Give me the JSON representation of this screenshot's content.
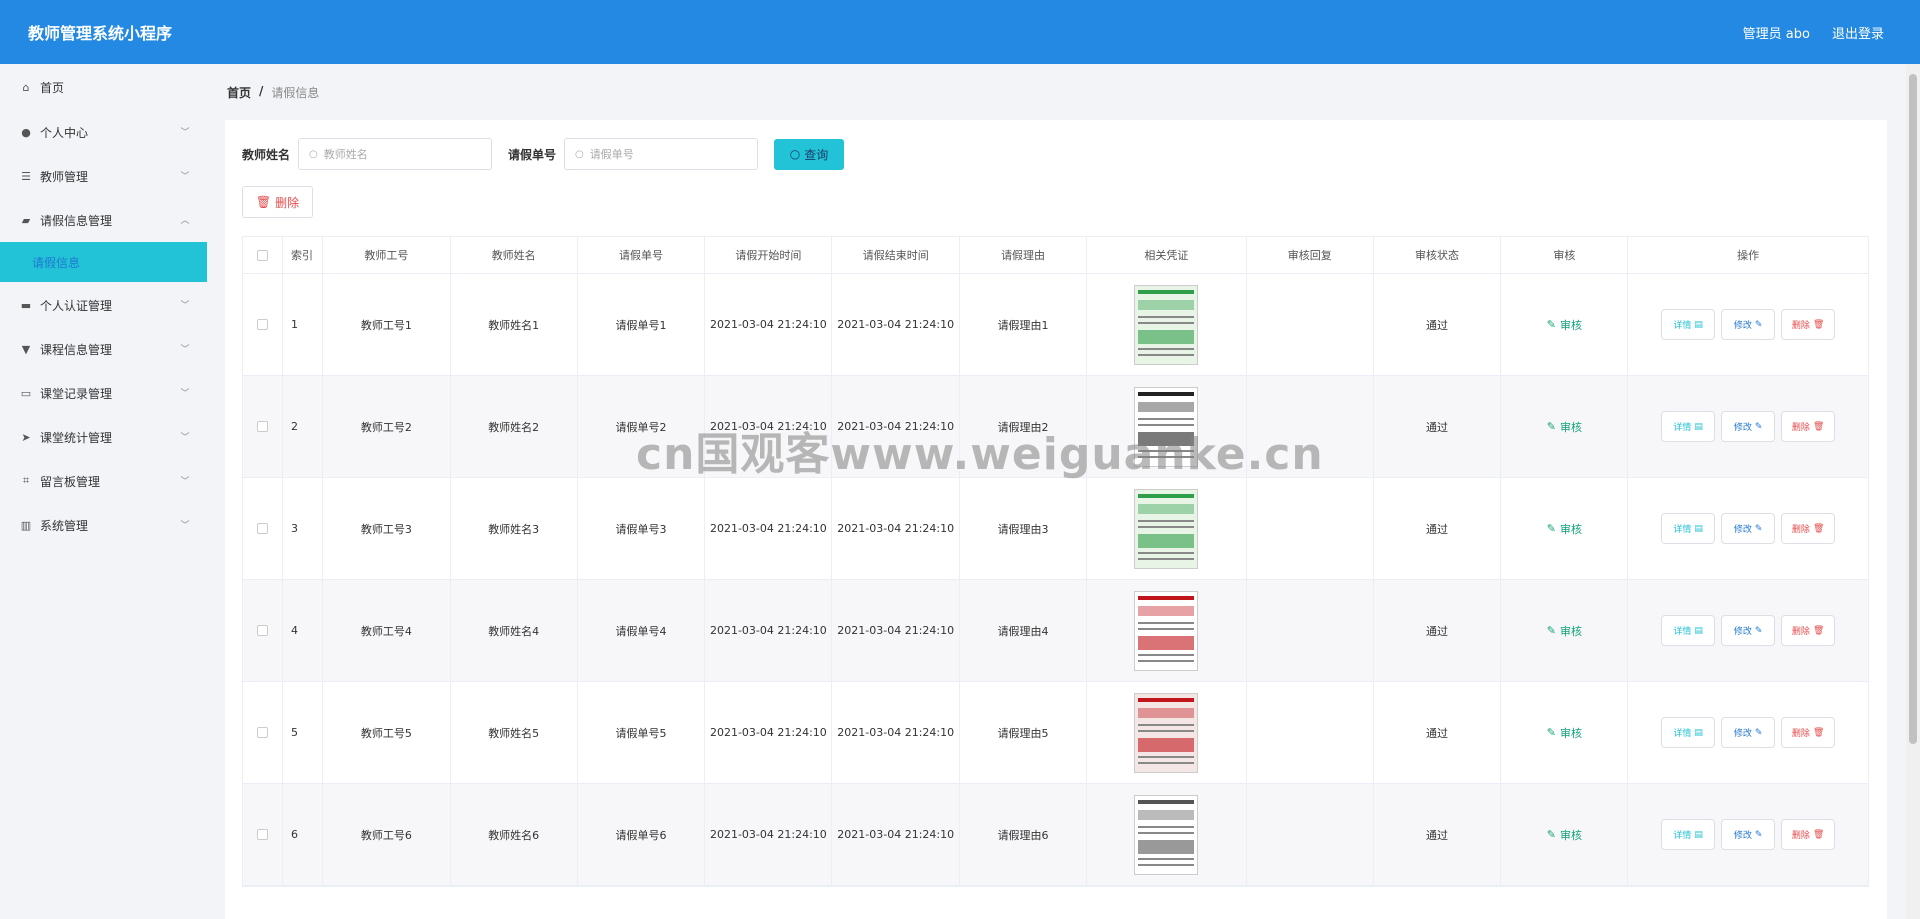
{
  "header": {
    "title": "教师管理系统小程序",
    "admin": "管理员 abo",
    "logout": "退出登录"
  },
  "sidebar": {
    "items": [
      {
        "label": "首页",
        "icon": "home-icon",
        "chevron": false
      },
      {
        "label": "个人中心",
        "icon": "user-icon",
        "chevron": true
      },
      {
        "label": "教师管理",
        "icon": "list-icon",
        "chevron": true
      },
      {
        "label": "请假信息管理",
        "icon": "folder-icon",
        "chevron": true,
        "expanded": true
      },
      {
        "label": "个人认证管理",
        "icon": "card-icon",
        "chevron": true
      },
      {
        "label": "课程信息管理",
        "icon": "book-icon",
        "chevron": true
      },
      {
        "label": "课堂记录管理",
        "icon": "message-icon",
        "chevron": true
      },
      {
        "label": "课堂统计管理",
        "icon": "send-icon",
        "chevron": true
      },
      {
        "label": "留言板管理",
        "icon": "crop-icon",
        "chevron": true
      },
      {
        "label": "系统管理",
        "icon": "chart-icon",
        "chevron": true
      }
    ],
    "subitem": "请假信息"
  },
  "breadcrumb": {
    "home": "首页",
    "sep": "/",
    "current": "请假信息"
  },
  "search": {
    "name_label": "教师姓名",
    "name_placeholder": "教师姓名",
    "no_label": "请假单号",
    "no_placeholder": "请假单号",
    "query": "查询"
  },
  "toolbar": {
    "delete": "删除"
  },
  "table": {
    "headers": [
      "",
      "索引",
      "教师工号",
      "教师姓名",
      "请假单号",
      "请假开始时间",
      "请假结束时间",
      "请假理由",
      "相关凭证",
      "审核回复",
      "审核状态",
      "审核",
      "操作"
    ],
    "rows": [
      {
        "index": "1",
        "no": "教师工号1",
        "name": "教师姓名1",
        "leave": "请假单号1",
        "start": "2021-03-04 21:24:10",
        "end": "2021-03-04 21:24:10",
        "reason": "请假理由1",
        "reply": "",
        "status": "通过",
        "audit": "审核"
      },
      {
        "index": "2",
        "no": "教师工号2",
        "name": "教师姓名2",
        "leave": "请假单号2",
        "start": "2021-03-04 21:24:10",
        "end": "2021-03-04 21:24:10",
        "reason": "请假理由2",
        "reply": "",
        "status": "通过",
        "audit": "审核"
      },
      {
        "index": "3",
        "no": "教师工号3",
        "name": "教师姓名3",
        "leave": "请假单号3",
        "start": "2021-03-04 21:24:10",
        "end": "2021-03-04 21:24:10",
        "reason": "请假理由3",
        "reply": "",
        "status": "通过",
        "audit": "审核"
      },
      {
        "index": "4",
        "no": "教师工号4",
        "name": "教师姓名4",
        "leave": "请假单号4",
        "start": "2021-03-04 21:24:10",
        "end": "2021-03-04 21:24:10",
        "reason": "请假理由4",
        "reply": "",
        "status": "通过",
        "audit": "审核"
      },
      {
        "index": "5",
        "no": "教师工号5",
        "name": "教师姓名5",
        "leave": "请假单号5",
        "start": "2021-03-04 21:24:10",
        "end": "2021-03-04 21:24:10",
        "reason": "请假理由5",
        "reply": "",
        "status": "通过",
        "audit": "审核"
      },
      {
        "index": "6",
        "no": "教师工号6",
        "name": "教师姓名6",
        "leave": "请假单号6",
        "start": "2021-03-04 21:24:10",
        "end": "2021-03-04 21:24:10",
        "reason": "请假理由6",
        "reply": "",
        "status": "通过",
        "audit": "审核"
      }
    ],
    "ops": {
      "detail": "详情",
      "edit": "修改",
      "delete": "删除"
    }
  },
  "watermark": "cn国观客www.weiguanke.cn",
  "colors": {
    "header": "#2389e2",
    "accent": "#22c3d6",
    "danger": "#e64b4b",
    "success": "#12a37a"
  }
}
